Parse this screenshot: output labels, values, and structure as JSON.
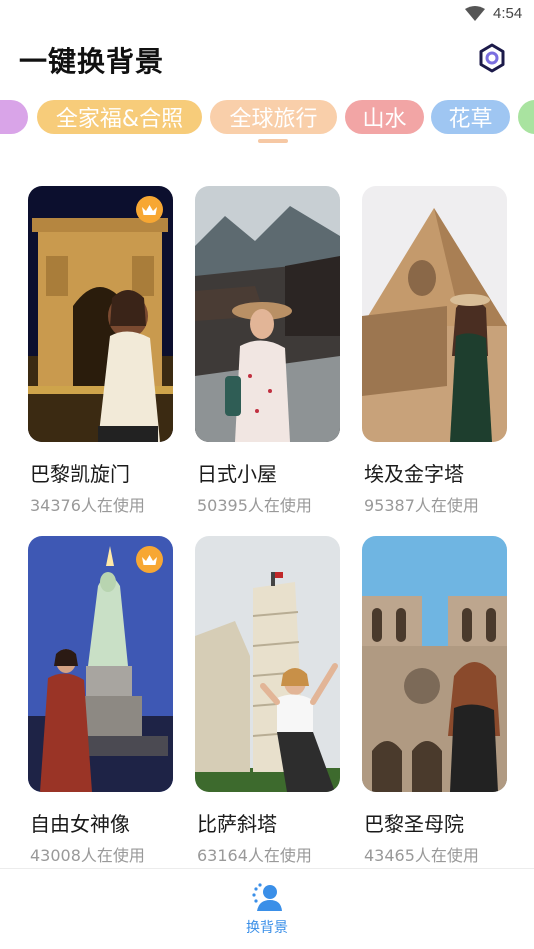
{
  "status_bar": {
    "time": "4:54",
    "wifi_icon": "wifi-icon"
  },
  "header": {
    "title": "一键换背景",
    "settings_icon": "settings-hexagon-icon"
  },
  "tabs": [
    {
      "label": "",
      "color": "#d9a4e8"
    },
    {
      "label": "全家福&合照",
      "color": "#f7cc7a"
    },
    {
      "label": "全球旅行",
      "color": "#f9cfaa",
      "active": true
    },
    {
      "label": "山水",
      "color": "#f2a5a5"
    },
    {
      "label": "花草",
      "color": "#9fc6f2"
    },
    {
      "label": "",
      "color": "#a9e3a0"
    }
  ],
  "accent_color": "#3a8fe8",
  "crown_color": "#f7a733",
  "cards": [
    {
      "name": "巴黎凯旋门",
      "count": "34376",
      "unit": "人在使用",
      "vip": true,
      "crown_icon": "crown-icon"
    },
    {
      "name": "日式小屋",
      "count": "50395",
      "unit": "人在使用",
      "vip": false
    },
    {
      "name": "埃及金字塔",
      "count": "95387",
      "unit": "人在使用",
      "vip": false
    },
    {
      "name": "自由女神像",
      "count": "43008",
      "unit": "人在使用",
      "vip": true,
      "crown_icon": "crown-icon"
    },
    {
      "name": "比萨斜塔",
      "count": "63164",
      "unit": "人在使用",
      "vip": false
    },
    {
      "name": "巴黎圣母院",
      "count": "43465",
      "unit": "人在使用",
      "vip": false
    }
  ],
  "bottom_nav": {
    "label": "换背景",
    "icon": "user-swap-icon"
  }
}
